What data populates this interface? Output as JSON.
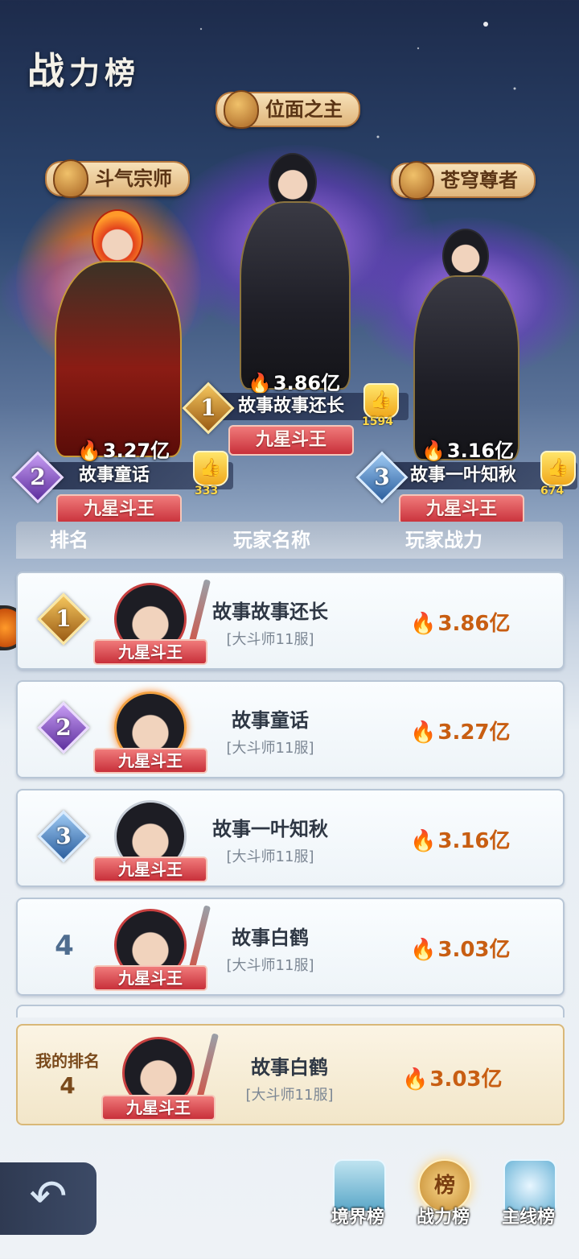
{
  "page_title": {
    "main": "战",
    "rest": "力榜"
  },
  "podium": [
    {
      "rank": "1",
      "honor": "位面之主",
      "power": "3.86亿",
      "name": "故事故事还长",
      "likes": "1594",
      "badge": "九星斗王"
    },
    {
      "rank": "2",
      "honor": "斗气宗师",
      "power": "3.27亿",
      "name": "故事童话",
      "likes": "333",
      "badge": "九星斗王"
    },
    {
      "rank": "3",
      "honor": "苍穹尊者",
      "power": "3.16亿",
      "name": "故事一叶知秋",
      "likes": "674",
      "badge": "九星斗王"
    }
  ],
  "table": {
    "headers": {
      "rank": "排名",
      "name": "玩家名称",
      "power": "玩家战力"
    },
    "rows": [
      {
        "rank": "1",
        "name": "故事故事还长",
        "server": "[大斗师11服]",
        "power": "3.86亿",
        "badge": "九星斗王"
      },
      {
        "rank": "2",
        "name": "故事童话",
        "server": "[大斗师11服]",
        "power": "3.27亿",
        "badge": "九星斗王"
      },
      {
        "rank": "3",
        "name": "故事一叶知秋",
        "server": "[大斗师11服]",
        "power": "3.16亿",
        "badge": "九星斗王"
      },
      {
        "rank": "4",
        "name": "故事白鹤",
        "server": "[大斗师11服]",
        "power": "3.03亿",
        "badge": "九星斗王"
      }
    ]
  },
  "my_rank": {
    "label": "我的排名",
    "rank": "4",
    "name": "故事白鹤",
    "server": "[大斗师11服]",
    "power": "3.03亿",
    "badge": "九星斗王"
  },
  "nav": {
    "back_glyph": "↶",
    "tabs": [
      {
        "label": "境界榜",
        "icon": "pagoda-icon"
      },
      {
        "label": "战力榜",
        "icon": "scroll-icon",
        "icon_text": "榜",
        "active": true
      },
      {
        "label": "主线榜",
        "icon": "flame-icon"
      }
    ]
  },
  "icons": {
    "power": "flame-icon",
    "like": "thumbs-up-icon"
  },
  "colors": {
    "badge_red": "#c8303a",
    "gold_rank": "#f3c45c",
    "purple_rank": "#5e2f9e",
    "blue_rank": "#2c5f9e",
    "power_text": "#c85e12"
  }
}
